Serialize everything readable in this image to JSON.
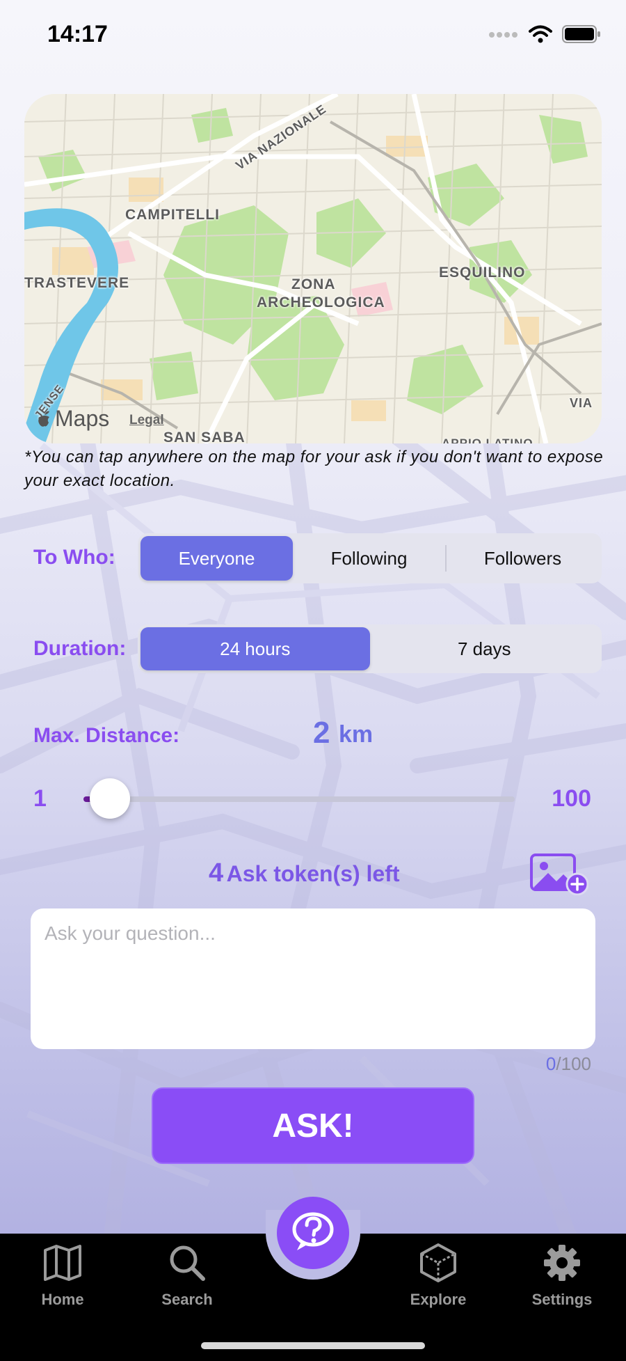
{
  "status_bar": {
    "time": "14:17"
  },
  "map": {
    "labels": [
      "VIA NAZIONALE",
      "CAMPITELLI",
      "TRASTEVERE",
      "ZONA",
      "ARCHEOLOGICA",
      "ESQUILINO",
      "SAN SABA",
      "VIA",
      "JENSE",
      "APPIO LATINO"
    ],
    "brand": "Maps",
    "legal": "Legal"
  },
  "note": "*You can tap anywhere on the map for your ask if you don't want to expose your exact location.",
  "audience": {
    "label": "To Who:",
    "options": [
      "Everyone",
      "Following",
      "Followers"
    ],
    "selected": "Everyone"
  },
  "duration": {
    "label": "Duration:",
    "options": [
      "24 hours",
      "7 days"
    ],
    "selected": "24 hours"
  },
  "distance": {
    "label": "Max. Distance:",
    "value": "2",
    "unit": "km",
    "min": "1",
    "max": "100",
    "slider_value": 2
  },
  "tokens": {
    "count": "4",
    "text": "Ask token(s) left"
  },
  "question": {
    "placeholder": "Ask your question...",
    "count": "0",
    "max": "/100"
  },
  "ask_button": "ASK!",
  "tabs": {
    "home": "Home",
    "search": "Search",
    "explore": "Explore",
    "settings": "Settings"
  },
  "colors": {
    "accent": "#8a4df6",
    "selected_segment": "#6b6fe3",
    "label": "#8a4df0"
  }
}
